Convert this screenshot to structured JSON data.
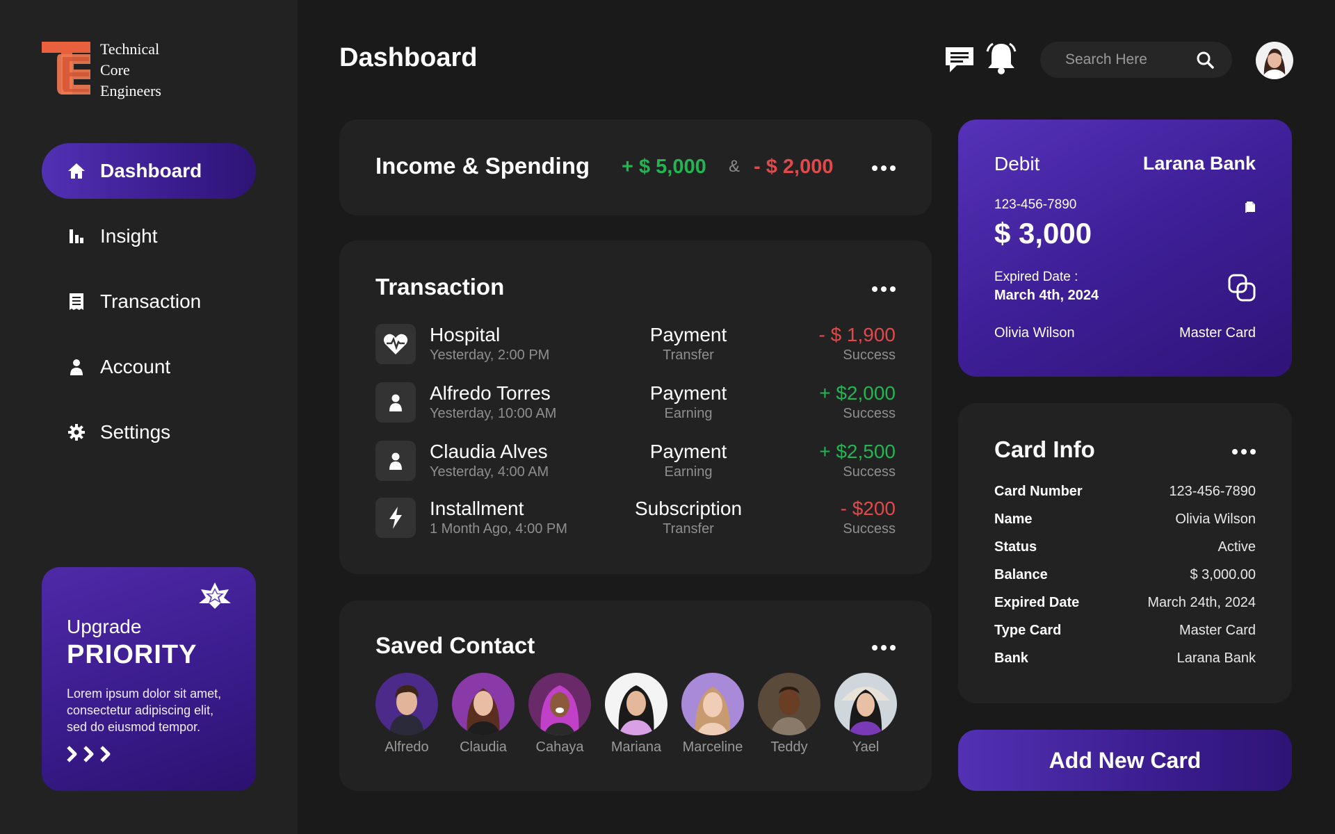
{
  "brand": {
    "line1": "Technical",
    "line2": "Core",
    "line3": "Engineers"
  },
  "sidebar": {
    "items": [
      {
        "label": "Dashboard",
        "icon": "home-icon",
        "active": true
      },
      {
        "label": "Insight",
        "icon": "bar-chart-icon"
      },
      {
        "label": "Transaction",
        "icon": "receipt-icon"
      },
      {
        "label": "Account",
        "icon": "user-icon"
      },
      {
        "label": "Settings",
        "icon": "gear-icon"
      }
    ]
  },
  "upgrade": {
    "title": "Upgrade",
    "strong": "PRIORITY",
    "desc": "Lorem ipsum dolor sit amet, consectetur adipiscing elit, sed do eiusmod tempor."
  },
  "header": {
    "title": "Dashboard",
    "search_placeholder": "Search Here"
  },
  "income": {
    "title": "Income & Spending",
    "plus": "+ $ 5,000",
    "amp": "&",
    "minus": "- $ 2,000"
  },
  "transaction": {
    "title": "Transaction",
    "rows": [
      {
        "name": "Hospital",
        "date": "Yesterday, 2:00 PM",
        "type": "Payment",
        "sub": "Transfer",
        "amount": "- $ 1,900",
        "status": "Success",
        "icon": "heartbeat-icon"
      },
      {
        "name": "Alfredo Torres",
        "date": "Yesterday, 10:00 AM",
        "type": "Payment",
        "sub": "Earning",
        "amount": "+ $2,000",
        "status": "Success",
        "icon": "user-icon"
      },
      {
        "name": "Claudia Alves",
        "date": "Yesterday, 4:00 AM",
        "type": "Payment",
        "sub": "Earning",
        "amount": "+ $2,500",
        "status": "Success",
        "icon": "user-icon"
      },
      {
        "name": "Installment",
        "date": "1 Month Ago, 4:00 PM",
        "type": "Subscription",
        "sub": "Transfer",
        "amount": "- $200",
        "status": "Success",
        "icon": "lightning-icon"
      }
    ]
  },
  "contacts": {
    "title": "Saved Contact",
    "items": [
      "Alfredo",
      "Claudia",
      "Cahaya",
      "Mariana",
      "Marceline",
      "Teddy",
      "Yael"
    ]
  },
  "debit": {
    "label": "Debit",
    "bank": "Larana Bank",
    "number": "123-456-7890",
    "balance": "$ 3,000",
    "expired_label": "Expired Date :",
    "expired_value": "March 4th, 2024",
    "holder": "Olivia Wilson",
    "card_type": "Master Card"
  },
  "card_info": {
    "title": "Card Info",
    "rows": [
      {
        "key": "Card Number",
        "value": "123-456-7890"
      },
      {
        "key": "Name",
        "value": "Olivia Wilson"
      },
      {
        "key": "Status",
        "value": "Active"
      },
      {
        "key": "Balance",
        "value": "$ 3,000.00"
      },
      {
        "key": "Expired Date",
        "value": "March 24th, 2024"
      },
      {
        "key": "Type Card",
        "value": "Master Card"
      },
      {
        "key": "Bank",
        "value": "Larana Bank"
      }
    ]
  },
  "add_card": {
    "label": "Add New Card"
  },
  "colors": {
    "accent": "#4a28a8",
    "positive": "#23b552",
    "negative": "#e04a4a",
    "logo": "#e8603c"
  }
}
